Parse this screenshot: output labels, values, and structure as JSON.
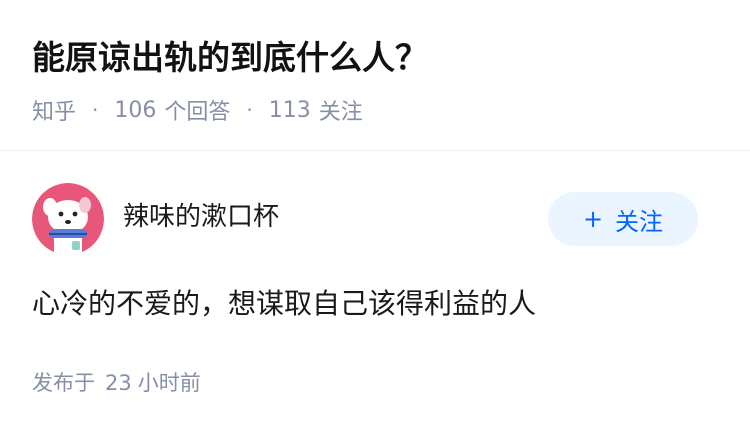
{
  "question": {
    "title": "能原谅出轨的到底什么人？",
    "source": "知乎",
    "answer_count": "106",
    "answer_label": "个回答",
    "follower_count": "113",
    "follower_label": "关注",
    "separator": "·"
  },
  "answer": {
    "author": {
      "name": "辣味的漱口杯",
      "avatar_icon": "dog-avatar-icon"
    },
    "follow_button": {
      "plus": "+",
      "label": "关注"
    },
    "content": "心冷的不爱的，想谋取自己该得利益的人",
    "published": {
      "prefix": "发布于",
      "amount": "23",
      "unit": "小时前"
    }
  },
  "colors": {
    "title": "#121212",
    "meta": "#8590a6",
    "follow_bg": "#ebf5ff",
    "follow_text": "#0066ff",
    "avatar_bg": "#e8567a"
  }
}
